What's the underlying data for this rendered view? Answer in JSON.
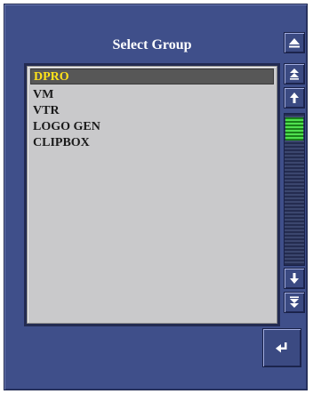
{
  "dialog": {
    "title": "Select Group"
  },
  "groups": {
    "selected_index": 0,
    "items": [
      {
        "label": "DPRO"
      },
      {
        "label": "VM"
      },
      {
        "label": "VTR"
      },
      {
        "label": "LOGO GEN"
      },
      {
        "label": "CLIPBOX"
      }
    ]
  },
  "scrollbar": {
    "thumb_color": "#4fe04f",
    "track_color": "#242c50"
  },
  "icons": {
    "top": "eject-icon",
    "page_up": "double-arrow-up-icon",
    "line_up": "arrow-up-icon",
    "line_down": "arrow-down-icon",
    "page_down": "double-arrow-down-icon",
    "enter": "enter-return-icon"
  },
  "colors": {
    "panel": "#3f4f8a",
    "list_background": "#c9c9cb",
    "selected_background": "#575757",
    "selected_text": "#ffe21a"
  }
}
